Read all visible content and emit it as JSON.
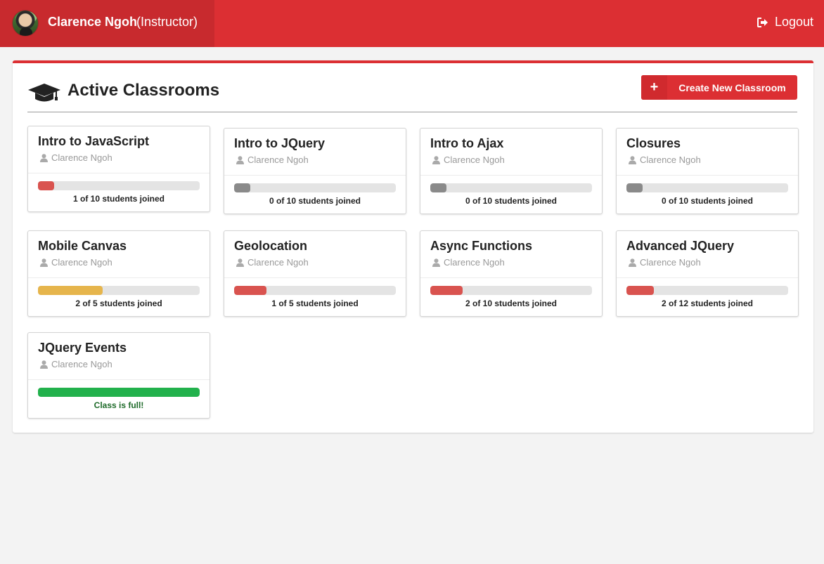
{
  "header": {
    "user_name": "Clarence Ngoh",
    "user_role": "(Instructor)",
    "logout_label": "Logout",
    "bar_color": "#dc2f33"
  },
  "panel": {
    "title": "Active Classrooms",
    "create_button_icon": "+",
    "create_button_label": "Create New Classroom"
  },
  "colors": {
    "accent": "#dc2f33",
    "progress_red": "#d9534f",
    "progress_yellow": "#e6b54c",
    "progress_green": "#22b14c",
    "progress_gray": "#8a8a8a"
  },
  "classrooms": [
    {
      "title": "Intro to JavaScript",
      "instructor": "Clarence Ngoh",
      "status": "1 of 10 students joined",
      "progress": 0.1,
      "color": "#d9534f"
    },
    {
      "title": "Intro to JQuery",
      "instructor": "Clarence Ngoh",
      "status": "0 of 10 students joined",
      "progress": 0.1,
      "color": "#8a8a8a"
    },
    {
      "title": "Intro to Ajax",
      "instructor": "Clarence Ngoh",
      "status": "0 of 10 students joined",
      "progress": 0.1,
      "color": "#8a8a8a"
    },
    {
      "title": "Closures",
      "instructor": "Clarence Ngoh",
      "status": "0 of 10 students joined",
      "progress": 0.1,
      "color": "#8a8a8a"
    },
    {
      "title": "Mobile Canvas",
      "instructor": "Clarence Ngoh",
      "status": "2 of 5 students joined",
      "progress": 0.4,
      "color": "#e6b54c"
    },
    {
      "title": "Geolocation",
      "instructor": "Clarence Ngoh",
      "status": "1 of 5 students joined",
      "progress": 0.2,
      "color": "#d9534f"
    },
    {
      "title": "Async Functions",
      "instructor": "Clarence Ngoh",
      "status": "2 of 10 students joined",
      "progress": 0.2,
      "color": "#d9534f"
    },
    {
      "title": "Advanced JQuery",
      "instructor": "Clarence Ngoh",
      "status": "2 of 12 students joined",
      "progress": 0.17,
      "color": "#d9534f"
    },
    {
      "title": "JQuery Events",
      "instructor": "Clarence Ngoh",
      "status": "Class is full!",
      "progress": 1.0,
      "color": "#22b14c",
      "full": true
    }
  ]
}
